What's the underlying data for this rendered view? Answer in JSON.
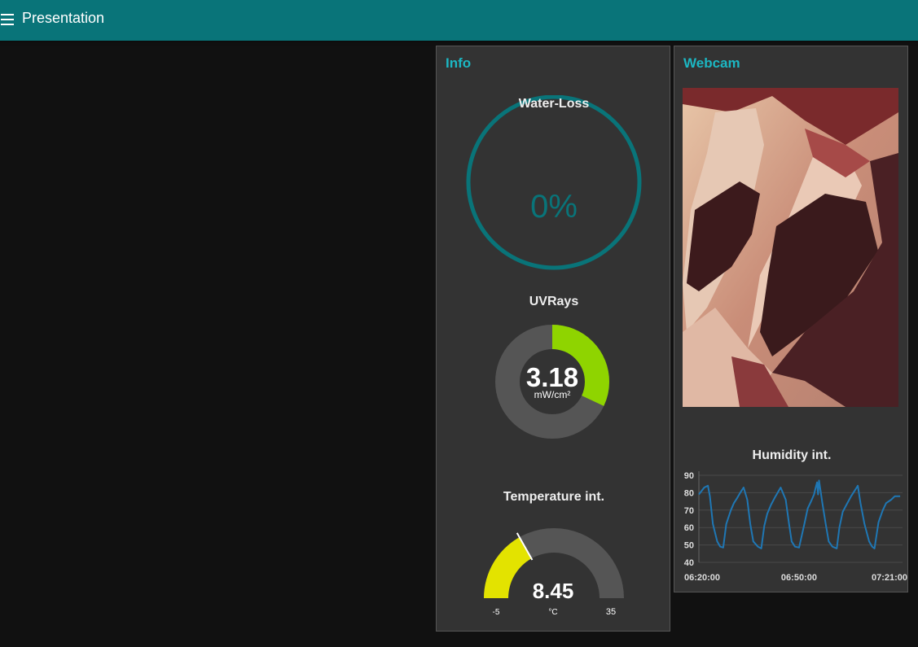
{
  "header": {
    "title": "Presentation",
    "menu_icon": "hamburger-menu-icon",
    "bg_color": "#097479"
  },
  "theme": {
    "accent": "#1cb7c3",
    "background": "#111111",
    "card_bg": "#333333"
  },
  "info_card": {
    "title": "Info",
    "water_loss": {
      "label": "Water-Loss",
      "value_text": "0%",
      "value": 0,
      "color": "#097479"
    },
    "uvrays": {
      "label": "UVRays",
      "value": 3.18,
      "value_text": "3.18",
      "unit": "mW/cm²",
      "fill_fraction": 0.32,
      "color": "#8fd400"
    },
    "temperature": {
      "label": "Temperature int.",
      "value": 8.45,
      "value_text": "8.45",
      "unit": "°C",
      "min": -5,
      "max": 35,
      "min_text": "-5",
      "max_text": "35",
      "color": "#e3e300"
    }
  },
  "webcam_card": {
    "title": "Webcam",
    "image": "webcam-image-meat",
    "humidity_chart": {
      "label": "Humidity int."
    }
  },
  "chart_data": {
    "type": "line",
    "title": "Humidity int.",
    "xlabel": "",
    "ylabel": "",
    "ylim": [
      40,
      90
    ],
    "yticks": [
      "90",
      "80",
      "70",
      "60",
      "50",
      "40"
    ],
    "xticks": [
      "06:20:00",
      "06:50:00",
      "07:21:00"
    ],
    "xlim_minutes": [
      0,
      61
    ],
    "grid": true,
    "series": [
      {
        "color": "#1f77b4",
        "x": [
          0,
          1.6,
          2.7,
          3.3,
          4.2,
          5.5,
          6.4,
          7.3,
          8.2,
          9.6,
          10.5,
          11.5,
          12.4,
          13.4,
          14.5,
          15.4,
          16.3,
          17.7,
          18.7,
          19.6,
          20.5,
          21.6,
          22.7,
          23.6,
          24.5,
          26.0,
          27.0,
          27.8,
          28.8,
          30.0,
          31.6,
          32.6,
          33.6,
          34.5,
          35.0,
          35.4,
          35.7,
          36.0,
          37.0,
          38.0,
          38.9,
          40.0,
          41.3,
          42.1,
          43.1,
          44.2,
          45.6,
          46.6,
          47.6,
          48.4,
          49.6,
          51.0,
          51.9,
          52.6,
          53.8,
          55.1,
          56.1,
          57.6,
          58.7,
          59.5,
          60.3
        ],
        "y": [
          79,
          83,
          84,
          78,
          62,
          52,
          49,
          48.5,
          62,
          70,
          74,
          77,
          80,
          83,
          76,
          62,
          52,
          49,
          48,
          61,
          68,
          73,
          77,
          80,
          83,
          76,
          62,
          52,
          49,
          48.5,
          62,
          71,
          75,
          79,
          83,
          86,
          79,
          87,
          74,
          62,
          52,
          49,
          48,
          60,
          69,
          73,
          78,
          81,
          84,
          74,
          62,
          52,
          49,
          48,
          63,
          70,
          74,
          76,
          78,
          78,
          78
        ]
      }
    ]
  }
}
